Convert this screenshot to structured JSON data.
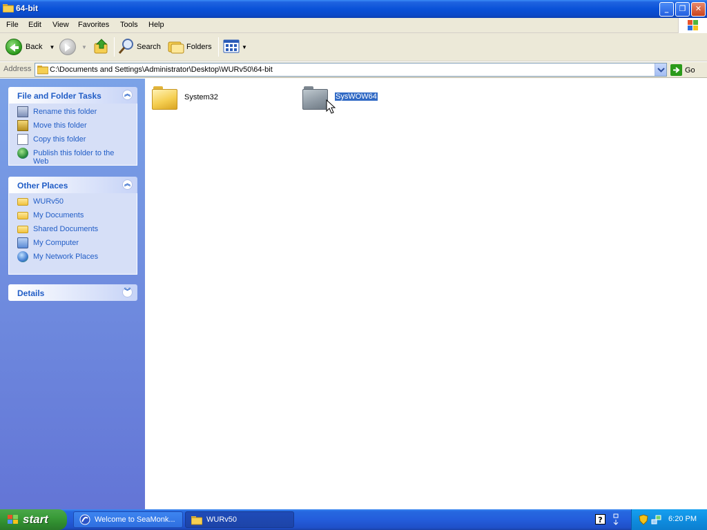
{
  "window": {
    "title": "64-bit",
    "buttons": {
      "minimize": "_",
      "restore": "❐",
      "close": "✕"
    }
  },
  "menu": [
    "File",
    "Edit",
    "View",
    "Favorites",
    "Tools",
    "Help"
  ],
  "toolbar": {
    "back_label": "Back",
    "search_label": "Search",
    "folders_label": "Folders"
  },
  "address": {
    "label": "Address",
    "value": "C:\\Documents and Settings\\Administrator\\Desktop\\WURv50\\64-bit",
    "go_label": "Go"
  },
  "tasks": {
    "title": "File and Folder Tasks",
    "items": [
      {
        "label": "Rename this folder",
        "icon": "rename-icon"
      },
      {
        "label": "Move this folder",
        "icon": "move-icon"
      },
      {
        "label": "Copy this folder",
        "icon": "copy-icon"
      },
      {
        "label": "Publish this folder to the Web",
        "icon": "publish-web-icon"
      }
    ]
  },
  "other_places": {
    "title": "Other Places",
    "items": [
      {
        "label": "WURv50",
        "icon": "folder-icon"
      },
      {
        "label": "My Documents",
        "icon": "my-documents-icon"
      },
      {
        "label": "Shared Documents",
        "icon": "folder-icon"
      },
      {
        "label": "My Computer",
        "icon": "my-computer-icon"
      },
      {
        "label": "My Network Places",
        "icon": "network-places-icon"
      }
    ]
  },
  "details": {
    "title": "Details"
  },
  "files": [
    {
      "name": "System32",
      "selected": false,
      "color": "#f5cf52"
    },
    {
      "name": "SysWOW64",
      "selected": true,
      "color": "#8f9aa4"
    }
  ],
  "taskbar": {
    "start_label": "start",
    "buttons": [
      {
        "label": "Welcome to SeaMonk...",
        "icon": "seamonkey-icon"
      },
      {
        "label": "WURv50",
        "icon": "folder-icon"
      }
    ],
    "clock": "6:20 PM",
    "help_glyph": "?"
  },
  "colors": {
    "selection": "#316ac5",
    "link": "#215dc6",
    "taskbar": "#245ddb",
    "start": "#399b38"
  }
}
